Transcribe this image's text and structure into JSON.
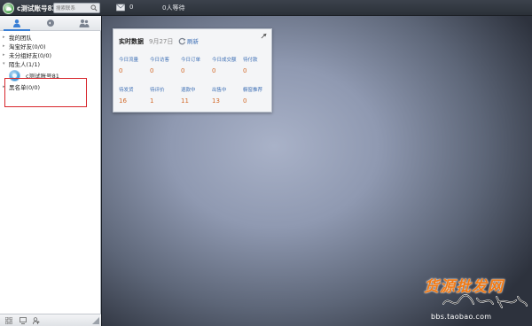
{
  "topbar": {
    "account_name": "c测试账号82",
    "search_placeholder": "搜索联系",
    "mail_count": "0",
    "waiting_text": "0人等待"
  },
  "left_panel": {
    "tabs": [
      {
        "icon": "person-icon",
        "active": true
      },
      {
        "icon": "chat-bubble-icon",
        "active": false
      },
      {
        "icon": "group-icon",
        "active": false
      }
    ],
    "groups": [
      {
        "label": "我的团队"
      },
      {
        "label": "淘宝好友(0/0)"
      },
      {
        "label": "未分组好友(0/0)"
      },
      {
        "label": "陌生人(1/1)"
      },
      {
        "label": "黑名单(0/0)"
      }
    ],
    "contact": {
      "name": "c测试账号81"
    },
    "bottom_icons": [
      "grid-icon",
      "monitor-icon",
      "add-contact-icon"
    ]
  },
  "realtime_card": {
    "title": "实时数据",
    "date": "9月27日",
    "refresh_label": "刷新",
    "stats_row1": [
      {
        "label": "今日流量",
        "value": "0"
      },
      {
        "label": "今日访客",
        "value": "0"
      },
      {
        "label": "今日订单",
        "value": "0"
      },
      {
        "label": "今日成交额",
        "value": "0"
      },
      {
        "label": "待付款",
        "value": "0"
      }
    ],
    "stats_row2": [
      {
        "label": "待发货",
        "value": "16"
      },
      {
        "label": "待评价",
        "value": "1"
      },
      {
        "label": "退款中",
        "value": "11"
      },
      {
        "label": "出售中",
        "value": "13"
      },
      {
        "label": "橱窗推荐",
        "value": "0"
      }
    ]
  },
  "watermark": {
    "title": "货源批发网",
    "url": "bbs.taobao.com"
  },
  "colors": {
    "accent_blue": "#3d6fb5",
    "value_orange": "#d26a2a",
    "highlight_red": "#d8262c"
  }
}
